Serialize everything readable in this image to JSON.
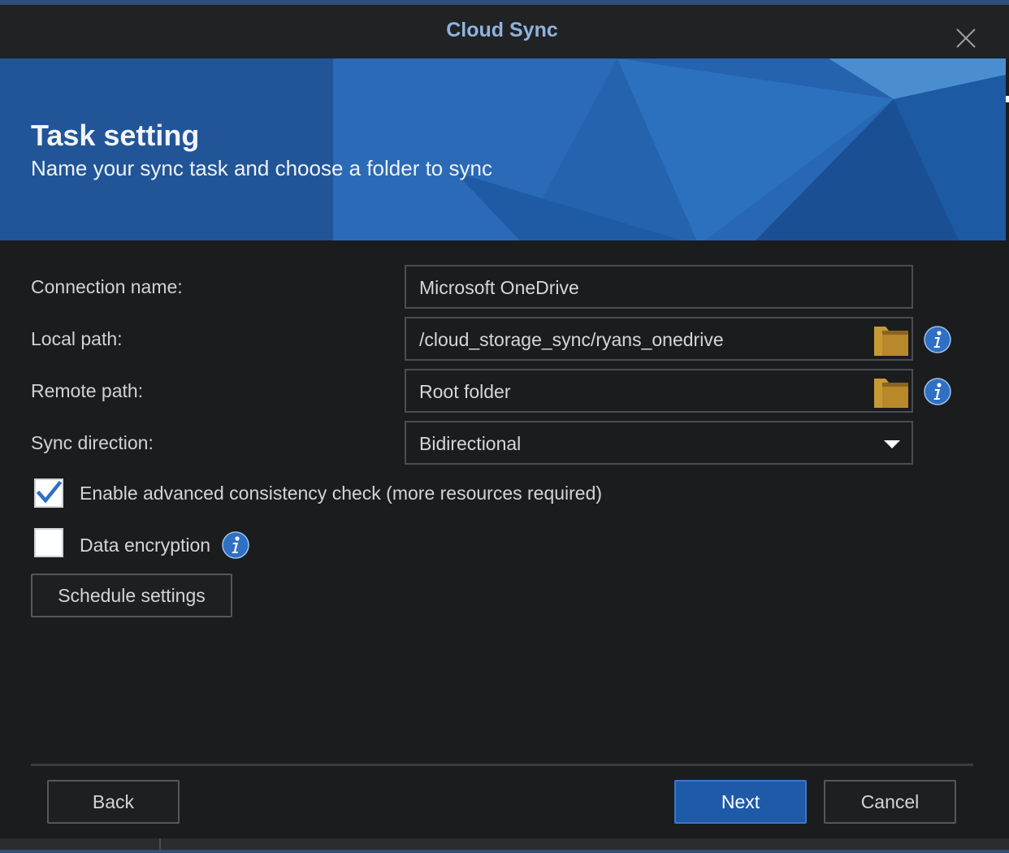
{
  "window": {
    "title": "Cloud Sync"
  },
  "banner": {
    "title": "Task setting",
    "subtitle": "Name your sync task and choose a folder to sync"
  },
  "form": {
    "connection_name": {
      "label": "Connection name:",
      "value": "Microsoft OneDrive"
    },
    "local_path": {
      "label": "Local path:",
      "value": "/cloud_storage_sync/ryans_onedrive"
    },
    "remote_path": {
      "label": "Remote path:",
      "value": "Root folder"
    },
    "sync_direction": {
      "label": "Sync direction:",
      "value": "Bidirectional"
    },
    "consistency_check": {
      "label": "Enable advanced consistency check (more resources required)",
      "checked": true
    },
    "data_encryption": {
      "label": "Data encryption",
      "checked": false
    },
    "schedule_button": "Schedule settings"
  },
  "footer": {
    "back": "Back",
    "next": "Next",
    "cancel": "Cancel"
  },
  "colors": {
    "accent": "#1f5aa8",
    "title_text": "#8fb3dc",
    "folder_icon": "#b8892a",
    "info_icon": "#2f6fc4",
    "background": "#1b1c1e"
  },
  "icons": [
    "close-icon",
    "folder-icon",
    "info-icon",
    "checkmark-icon",
    "chevron-down-icon"
  ]
}
